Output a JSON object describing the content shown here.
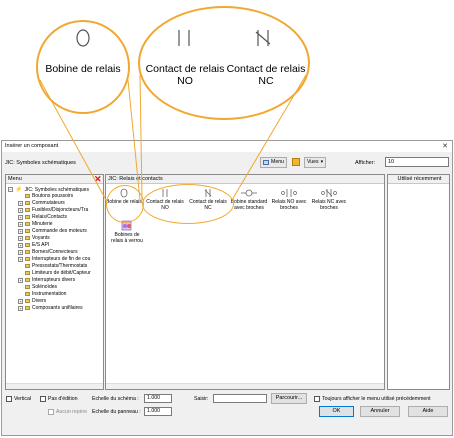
{
  "callout": {
    "bobine_label": "Bobine de relais",
    "contact_no_label_1": "Contact de relais",
    "contact_no_label_2": "NO",
    "contact_nc_label_1": "Contact de relais",
    "contact_nc_label_2": "NC"
  },
  "dialog": {
    "title": "Insérer un composant",
    "path": "JIC: Symboles schématiques",
    "menu_label": "Menu",
    "vues_label": "Vues",
    "afficher_label": "Afficher:",
    "afficher_value": "10"
  },
  "left_panel": {
    "header": "Menu",
    "root": "JIC: Symboles schématiques",
    "items": [
      "Boutons poussoirs",
      "Commutateurs",
      "Fusibles/Disjoncteurs/Tra",
      "Relais/Contacts",
      "Minuterie",
      "Commande des moteurs",
      "Voyants",
      "E/S API",
      "Bornes/Connecteurs",
      "Interrupteurs de fin de cou",
      "Pressostats/Thermostats",
      "Limiteurs de débit/Capteur",
      "Interrupteurs divers",
      "Solénoïdes",
      "Instrumentation",
      "Divers",
      "Composants unifilaires"
    ]
  },
  "middle_panel": {
    "header": "JIC: Relais et contacts",
    "symbols": [
      {
        "line1": "Bobine de relais",
        "line2": ""
      },
      {
        "line1": "Contact de relais",
        "line2": "NO"
      },
      {
        "line1": "Contact de relais",
        "line2": "NC"
      },
      {
        "line1": "Bobine standard",
        "line2": "avec broches"
      },
      {
        "line1": "Relais NO avec",
        "line2": "broches"
      },
      {
        "line1": "Relais NC avec",
        "line2": "broches"
      },
      {
        "line1": "Bobines de",
        "line2": "relais à verrou"
      }
    ]
  },
  "right_panel": {
    "header": "Utilisé récemment"
  },
  "bottom": {
    "vertical_label": "Vertical",
    "pas_edition_label": "Pas d'édition",
    "aucun_repere_label": "Aucun repère",
    "echelle_schema_label": "Echelle du schéma :",
    "echelle_schema_value": "1.000",
    "echelle_panneau_label": "Echelle du panneau :",
    "echelle_panneau_value": "1.000",
    "saisir_label": "Saisir:",
    "saisir_value": "",
    "parcourir_label": "Parcourir...",
    "toujours_label": "Toujours afficher le menu utilisé précédemment",
    "ok_label": "OK",
    "annuler_label": "Annuler",
    "aide_label": "Aide"
  },
  "colors": {
    "callout": "#f0a830",
    "delete_red": "#e01010"
  }
}
